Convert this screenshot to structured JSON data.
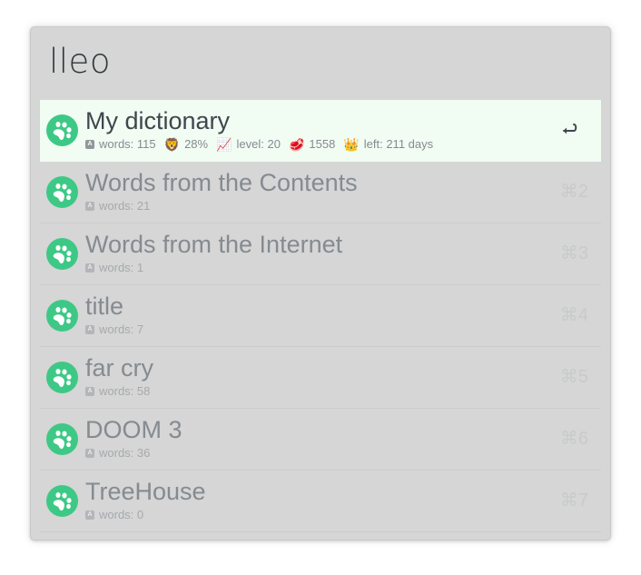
{
  "app": {
    "query": "lleo"
  },
  "results": [
    {
      "title": "My dictionary",
      "selected": true,
      "icon": "paw-icon",
      "action": "enter-icon",
      "stats": {
        "words_label": "words: 115",
        "progress": "28%",
        "progress_icon": "lion-emoji",
        "level": "level: 20",
        "level_icon": "chart-increasing-emoji",
        "meat": "1558",
        "meat_icon": "meat-emoji",
        "left": "left: 211 days",
        "left_icon": "crown-emoji"
      }
    },
    {
      "title": "Words from the Contents",
      "words_label": "words: 21",
      "shortcut": "⌘2",
      "icon": "paw-icon"
    },
    {
      "title": "Words from the Internet",
      "words_label": "words: 1",
      "shortcut": "⌘3",
      "icon": "paw-icon"
    },
    {
      "title": "title",
      "words_label": "words: 7",
      "shortcut": "⌘4",
      "icon": "paw-icon"
    },
    {
      "title": "far cry",
      "words_label": "words: 58",
      "shortcut": "⌘5",
      "icon": "paw-icon"
    },
    {
      "title": "DOOM 3",
      "words_label": "words: 36",
      "shortcut": "⌘6",
      "icon": "paw-icon"
    },
    {
      "title": "TreeHouse",
      "words_label": "words: 0",
      "shortcut": "⌘7",
      "icon": "paw-icon"
    }
  ],
  "glyphs": {
    "a_badge": "A",
    "lion": "🦁",
    "chart": "📈",
    "meat": "🥩",
    "crown": "👑"
  },
  "colors": {
    "accent_green": "#3ec886",
    "selected_row_bg": "#f1fcf3",
    "window_bg": "#d5d6d5"
  }
}
